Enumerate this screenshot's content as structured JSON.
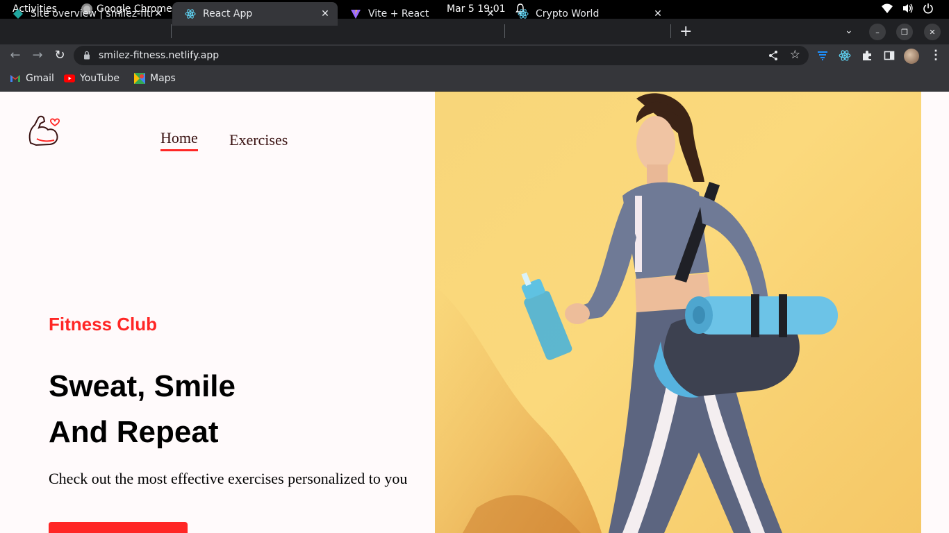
{
  "system_bar": {
    "activities": "Activities",
    "app_name": "Google Chrome",
    "clock": "Mar 5  19:01"
  },
  "browser": {
    "tabs": [
      {
        "title": "Site overview | smilez-fitn",
        "favicon": "netlify-icon",
        "active": false
      },
      {
        "title": "React App",
        "favicon": "react-icon",
        "active": true
      },
      {
        "title": "Vite + React",
        "favicon": "vite-icon",
        "active": false
      },
      {
        "title": "Crypto World",
        "favicon": "react-icon",
        "active": false
      }
    ],
    "url": "smilez-fitness.netlify.app",
    "bookmarks": [
      {
        "label": "Gmail",
        "icon": "gmail-icon"
      },
      {
        "label": "YouTube",
        "icon": "youtube-icon"
      },
      {
        "label": "Maps",
        "icon": "maps-icon"
      }
    ]
  },
  "site": {
    "nav": {
      "home": "Home",
      "exercises": "Exercises"
    },
    "hero": {
      "eyebrow": "Fitness Club",
      "headline_line1": "Sweat, Smile",
      "headline_line2": "And Repeat",
      "subtitle": "Check out the most effective exercises personalized to you"
    },
    "colors": {
      "accent": "#ff2625",
      "hero_bg": "#fbd97c",
      "page_bg": "#fffafb"
    }
  }
}
